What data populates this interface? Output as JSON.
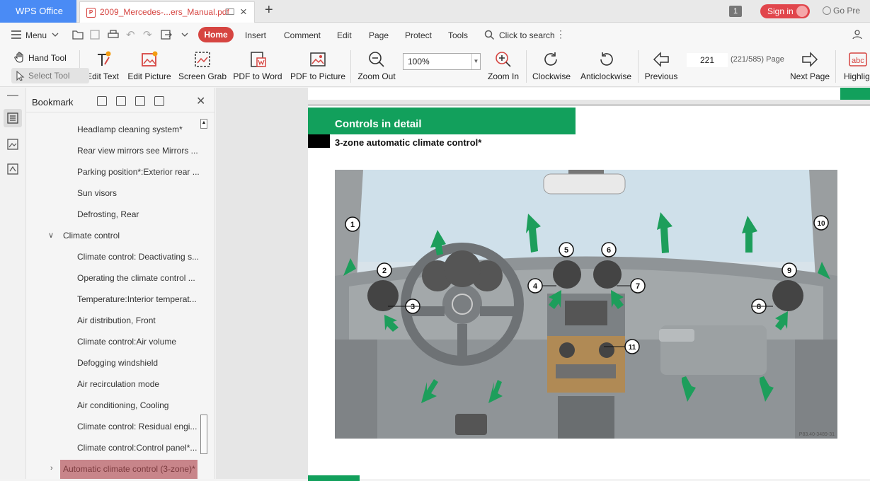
{
  "app": {
    "name": "WPS Office"
  },
  "tabs": [
    {
      "label": "2009_Mercedes-...ers_Manual.pdf"
    }
  ],
  "titlebar": {
    "page_badge": "1",
    "signin": "Sign in",
    "go_premium": "Go Pre"
  },
  "menu": {
    "menu_label": "Menu",
    "items": [
      "Home",
      "Insert",
      "Comment",
      "Edit",
      "Page",
      "Protect",
      "Tools"
    ],
    "search_label": "Click to search"
  },
  "toolbar": {
    "hand_tool": "Hand Tool",
    "select_tool": "Select Tool",
    "edit_text": "Edit Text",
    "edit_picture": "Edit Picture",
    "screen_grab": "Screen Grab",
    "pdf_to_word": "PDF to Word",
    "pdf_to_picture": "PDF to Picture",
    "zoom_out": "Zoom Out",
    "zoom_value": "100%",
    "zoom_in": "Zoom In",
    "clockwise": "Clockwise",
    "anticlockwise": "Anticlockwise",
    "previous": "Previous",
    "page_number": "221",
    "page_count": "(221/585) Page",
    "next_page": "Next Page",
    "highlight": "Highlig"
  },
  "bookmark": {
    "title": "Bookmark",
    "items": [
      "Headlamp cleaning system*",
      "Rear view mirrors see Mirrors ...",
      "Parking position*:Exterior rear ...",
      "Sun visors",
      "Defrosting, Rear",
      "Climate control",
      "Climate control: Deactivating s...",
      "Operating the climate control ...",
      "Temperature:Interior temperat...",
      "Air distribution, Front",
      "Climate control:Air volume",
      "Defogging windshield",
      "Air recirculation mode",
      "Air conditioning, Cooling",
      "Climate control: Residual engi...",
      "Climate control:Control panel*...",
      "Automatic climate control (3-zone)*"
    ]
  },
  "document": {
    "section_title": "Controls in detail",
    "subtitle": "3-zone automatic climate control*",
    "figure_code": "P83.40-3489-31",
    "callouts": [
      "1",
      "2",
      "3",
      "4",
      "5",
      "6",
      "7",
      "8",
      "9",
      "10",
      "11"
    ]
  },
  "colors": {
    "accent": "#d64541",
    "wps_blue": "#4a8bf5",
    "mercedes_green": "#12a05c"
  }
}
